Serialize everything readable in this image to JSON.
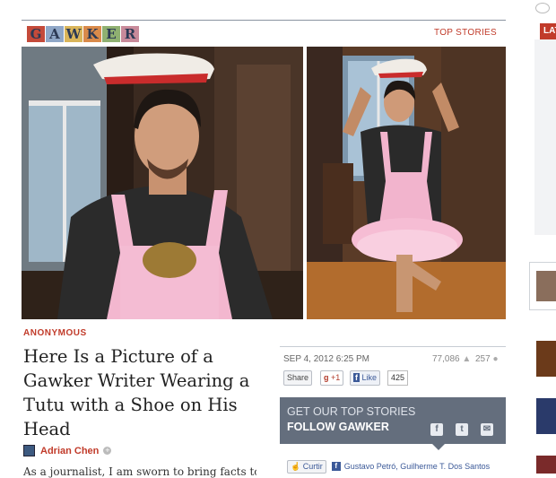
{
  "header": {
    "logo_letters": [
      "G",
      "A",
      "W",
      "K",
      "E",
      "R"
    ],
    "logo_tile_colors": [
      "#c44a3a",
      "#8fa7c7",
      "#d9b55a",
      "#d98a4a",
      "#8fb071",
      "#c88a9a"
    ],
    "top_stories_link": "TOP STORIES"
  },
  "article": {
    "kicker": "ANONYMOUS",
    "headline": "Here Is a Picture of a Gawker Writer Wearing a Tutu with a Shoe on His Head",
    "author": "Adrian Chen",
    "body_start": "As a journalist, I am sworn to bring facts to"
  },
  "meta": {
    "date": "SEP 4, 2012 6:25 PM",
    "views": "77,086",
    "comments": "257",
    "share_label": "Share",
    "gplus_label": "+1",
    "like_label": "Like",
    "like_count": "425"
  },
  "follow_box": {
    "line1": "GET OUR TOP STORIES",
    "line2": "FOLLOW GAWKER",
    "icons": [
      "facebook-icon",
      "tumblr-icon",
      "email-icon"
    ]
  },
  "facebook_row": {
    "button_label": "Curtir",
    "friends": "Gustavo Petró, Guilherme T. Dos Santos"
  },
  "rail": {
    "tab_label": "LAT"
  },
  "colors": {
    "accent": "#c13b2a",
    "follow_box_bg": "#646e7d",
    "facebook_blue": "#3b5998"
  }
}
